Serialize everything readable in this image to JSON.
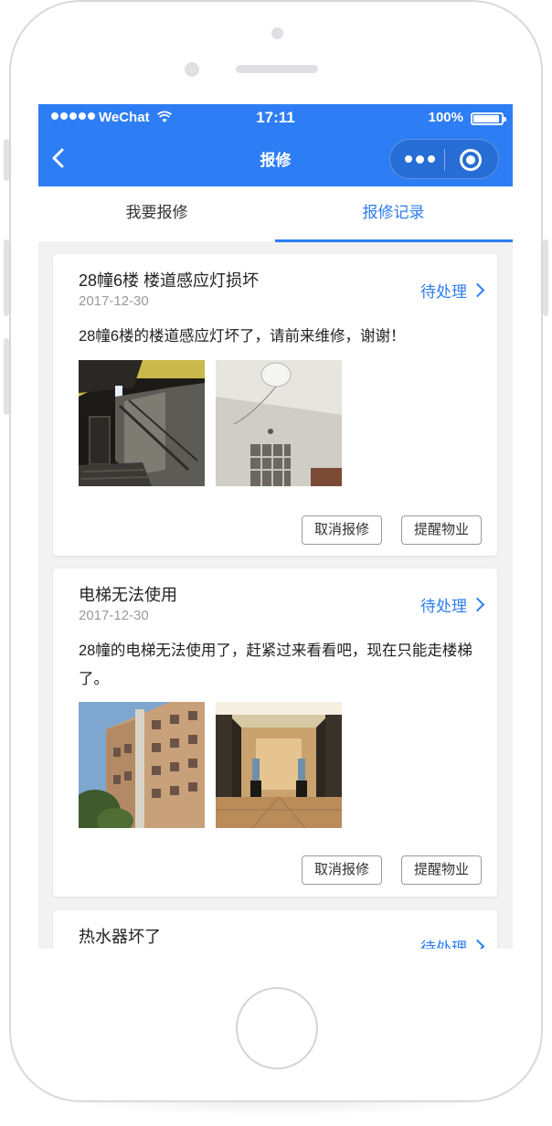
{
  "status_bar": {
    "carrier": "WeChat",
    "time": "17:11",
    "battery": "100%"
  },
  "nav": {
    "title": "报修"
  },
  "tabs": [
    {
      "label": "我要报修",
      "active": false
    },
    {
      "label": "报修记录",
      "active": true
    }
  ],
  "records": [
    {
      "title": "28幢6楼 楼道感应灯损坏",
      "date": "2017-12-30",
      "status": "待处理",
      "description": "28幢6楼的楼道感应灯坏了，请前来维修，谢谢！",
      "cancel_label": "取消报修",
      "remind_label": "提醒物业"
    },
    {
      "title": "电梯无法使用",
      "date": "2017-12-30",
      "status": "待处理",
      "description": "28幢的电梯无法使用了，赶紧过来看看吧，现在只能走楼梯了。",
      "cancel_label": "取消报修",
      "remind_label": "提醒物业"
    },
    {
      "title": "热水器坏了",
      "status": "待处理"
    }
  ],
  "colors": {
    "accent": "#2d7df4",
    "background": "#f2f2f2"
  }
}
